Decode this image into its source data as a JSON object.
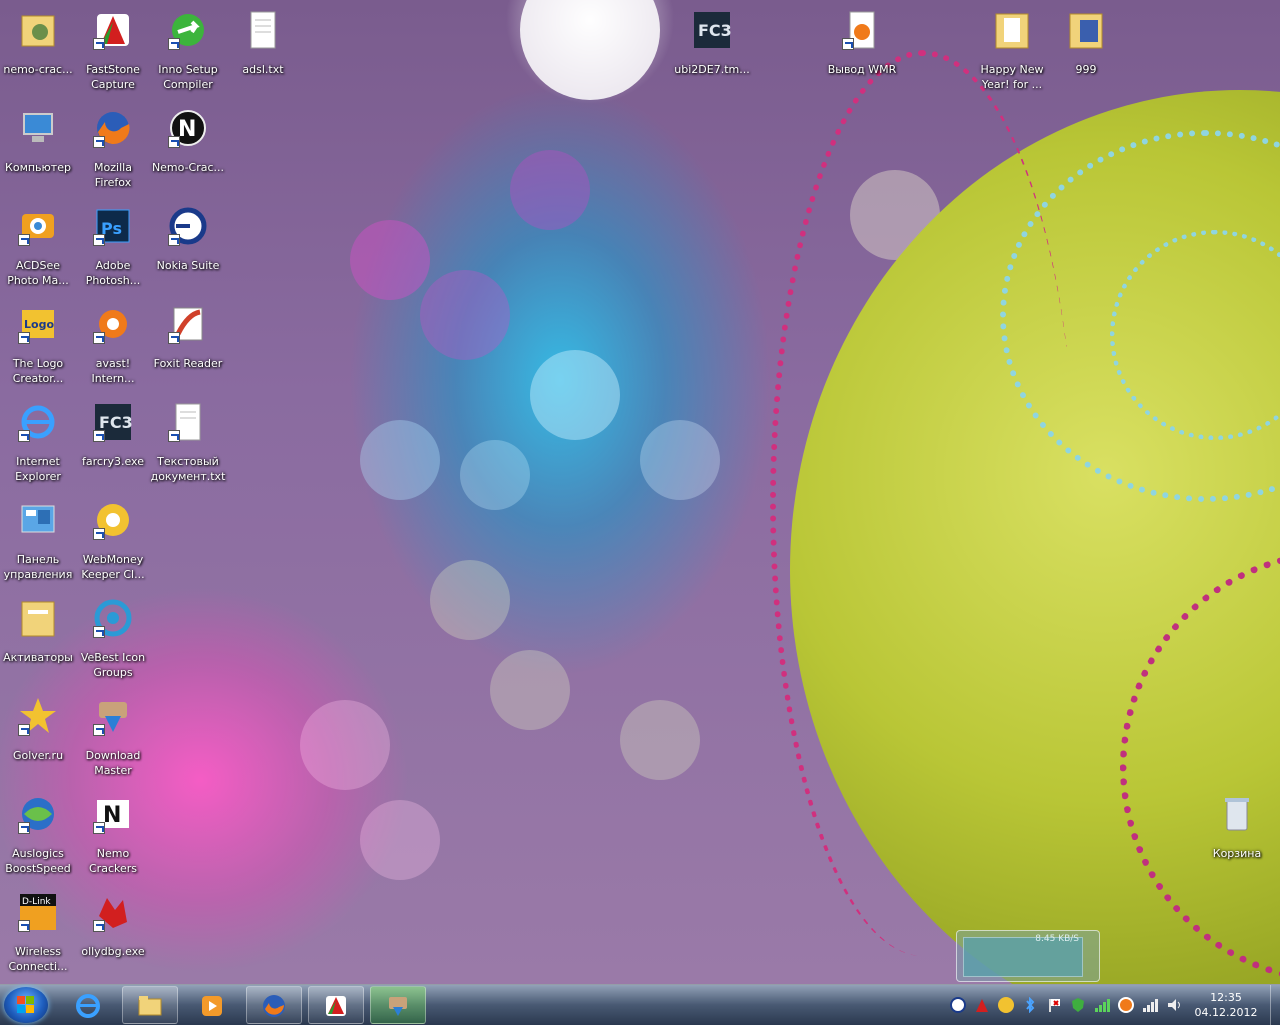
{
  "desktop": {
    "icons": [
      {
        "label": "nemo-crac...",
        "name": "nemo-crackers-folder"
      },
      {
        "label": "FastStone Capture",
        "name": "faststone-capture"
      },
      {
        "label": "Inno Setup Compiler",
        "name": "inno-setup-compiler"
      },
      {
        "label": "adsl.txt",
        "name": "adsl-txt"
      },
      {
        "label": "ubi2DE7.tm...",
        "name": "ubi2de7-tmp"
      },
      {
        "label": "Вывод WMR",
        "name": "vyvod-wmr"
      },
      {
        "label": "Happy New Year! for ...",
        "name": "happy-new-year-folder"
      },
      {
        "label": "999",
        "name": "folder-999"
      },
      {
        "label": "Компьютер",
        "name": "computer"
      },
      {
        "label": "Mozilla Firefox",
        "name": "mozilla-firefox"
      },
      {
        "label": "Nemo-Crac...",
        "name": "nemo-crackers-app"
      },
      {
        "label": "ACDSee Photo Ma...",
        "name": "acdsee-photo-manager"
      },
      {
        "label": "Adobe Photosh...",
        "name": "adobe-photoshop"
      },
      {
        "label": "Nokia Suite",
        "name": "nokia-suite"
      },
      {
        "label": "The Logo Creator...",
        "name": "logo-creator"
      },
      {
        "label": "avast! Intern...",
        "name": "avast-internet-security"
      },
      {
        "label": "Foxit Reader",
        "name": "foxit-reader"
      },
      {
        "label": "Internet Explorer",
        "name": "internet-explorer"
      },
      {
        "label": "farcry3.exe",
        "name": "farcry3-exe"
      },
      {
        "label": "Текстовый документ.txt",
        "name": "text-document-txt"
      },
      {
        "label": "Панель управления",
        "name": "control-panel"
      },
      {
        "label": "WebMoney Keeper Cl...",
        "name": "webmoney-keeper"
      },
      {
        "label": "Активаторы",
        "name": "activators-folder"
      },
      {
        "label": "VeBest Icon Groups",
        "name": "vebest-icon-groups"
      },
      {
        "label": "Golver.ru",
        "name": "golver-ru"
      },
      {
        "label": "Download Master",
        "name": "download-master"
      },
      {
        "label": "Auslogics BoostSpeed",
        "name": "auslogics-boostspeed"
      },
      {
        "label": "Nemo Crackers",
        "name": "nemo-crackers-shortcut"
      },
      {
        "label": "Wireless Connecti...",
        "name": "wireless-connection"
      },
      {
        "label": "ollydbg.exe",
        "name": "ollydbg-exe"
      },
      {
        "label": "Корзина",
        "name": "recycle-bin"
      }
    ]
  },
  "widget": {
    "rate": "8.45 KB/S"
  },
  "taskbar": {
    "clock_time": "12:35",
    "clock_date": "04.12.2012"
  }
}
